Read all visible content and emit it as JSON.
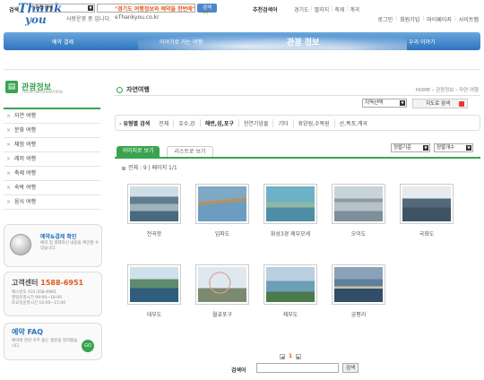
{
  "header": {
    "logo": "Thank you",
    "tagline": "사랑운영 중 입니다.",
    "promo_line1": "\"경기도 여행정보와 예약을 한번에\"",
    "promo_line2": "eThankyou.co.kr",
    "util_links": [
      "로그인",
      "회원가입",
      "마이페이지",
      "사이트맵"
    ]
  },
  "nav": {
    "items": [
      "예약 결제",
      "이야기로 가는 여행",
      "관광 정보",
      "우리 이야기"
    ],
    "active_index": 2
  },
  "search": {
    "label": "검색",
    "select_value": "통합검색",
    "input_value": "",
    "button_label": "검색",
    "recommended_label": "추천검색어",
    "recommended_items": [
      "경기도",
      "펼지지",
      "축제",
      "계곡"
    ]
  },
  "sidebar": {
    "title": "관광정보",
    "subtitle": "TOUR INFORMATION",
    "items": [
      "자연 여행",
      "문화 여행",
      "체험 여행",
      "레저 여행",
      "축제 여행",
      "숙박 여행",
      "음식 여행"
    ],
    "box_booking": {
      "title": "예약&결제 확인",
      "desc": "예약 및 결제하신 내용을 확인할 수 있습니다."
    },
    "box_center": {
      "title": "고객센터",
      "phone": "1588-6951",
      "lines": [
        "팩스번호 031-258-6981",
        "평일운영시간 09:00~18:00",
        "토요일운영시간 10:00~15:00"
      ]
    },
    "box_faq": {
      "title": "예약 FAQ",
      "desc": "예약에 관한 자주 묻는 질문을 정리했습니다.",
      "go": "GO"
    }
  },
  "main": {
    "page_title": "자연여행",
    "breadcrumb": "HOME › 관광정보 › 자연 여행",
    "region_select": "지역선택",
    "map_search_button": "지도로 검색",
    "filter_label": "유형별 검색",
    "filters": [
      "전체",
      "호수,강",
      "해변,섬,포구",
      "천연기념물",
      "기타",
      "휴양림,수목원",
      "산,폭포,계곡"
    ],
    "tab_image": "이미지로 보기",
    "tab_list": "리스트로 보기",
    "sort1": "정렬기준",
    "sort2": "정렬개수",
    "count_text": "전체 : 9 | 페이지 1/1",
    "items": [
      {
        "caption": "전곡항"
      },
      {
        "caption": "입파도"
      },
      {
        "caption": "화성3경 제부모세"
      },
      {
        "caption": "오이도"
      },
      {
        "caption": "국화도"
      },
      {
        "caption": "대부도"
      },
      {
        "caption": "월곶포구"
      },
      {
        "caption": "제부도"
      },
      {
        "caption": "궁평리"
      }
    ],
    "page_current": "1",
    "bottom_search_label": "검색어",
    "bottom_search_button": "검색"
  }
}
